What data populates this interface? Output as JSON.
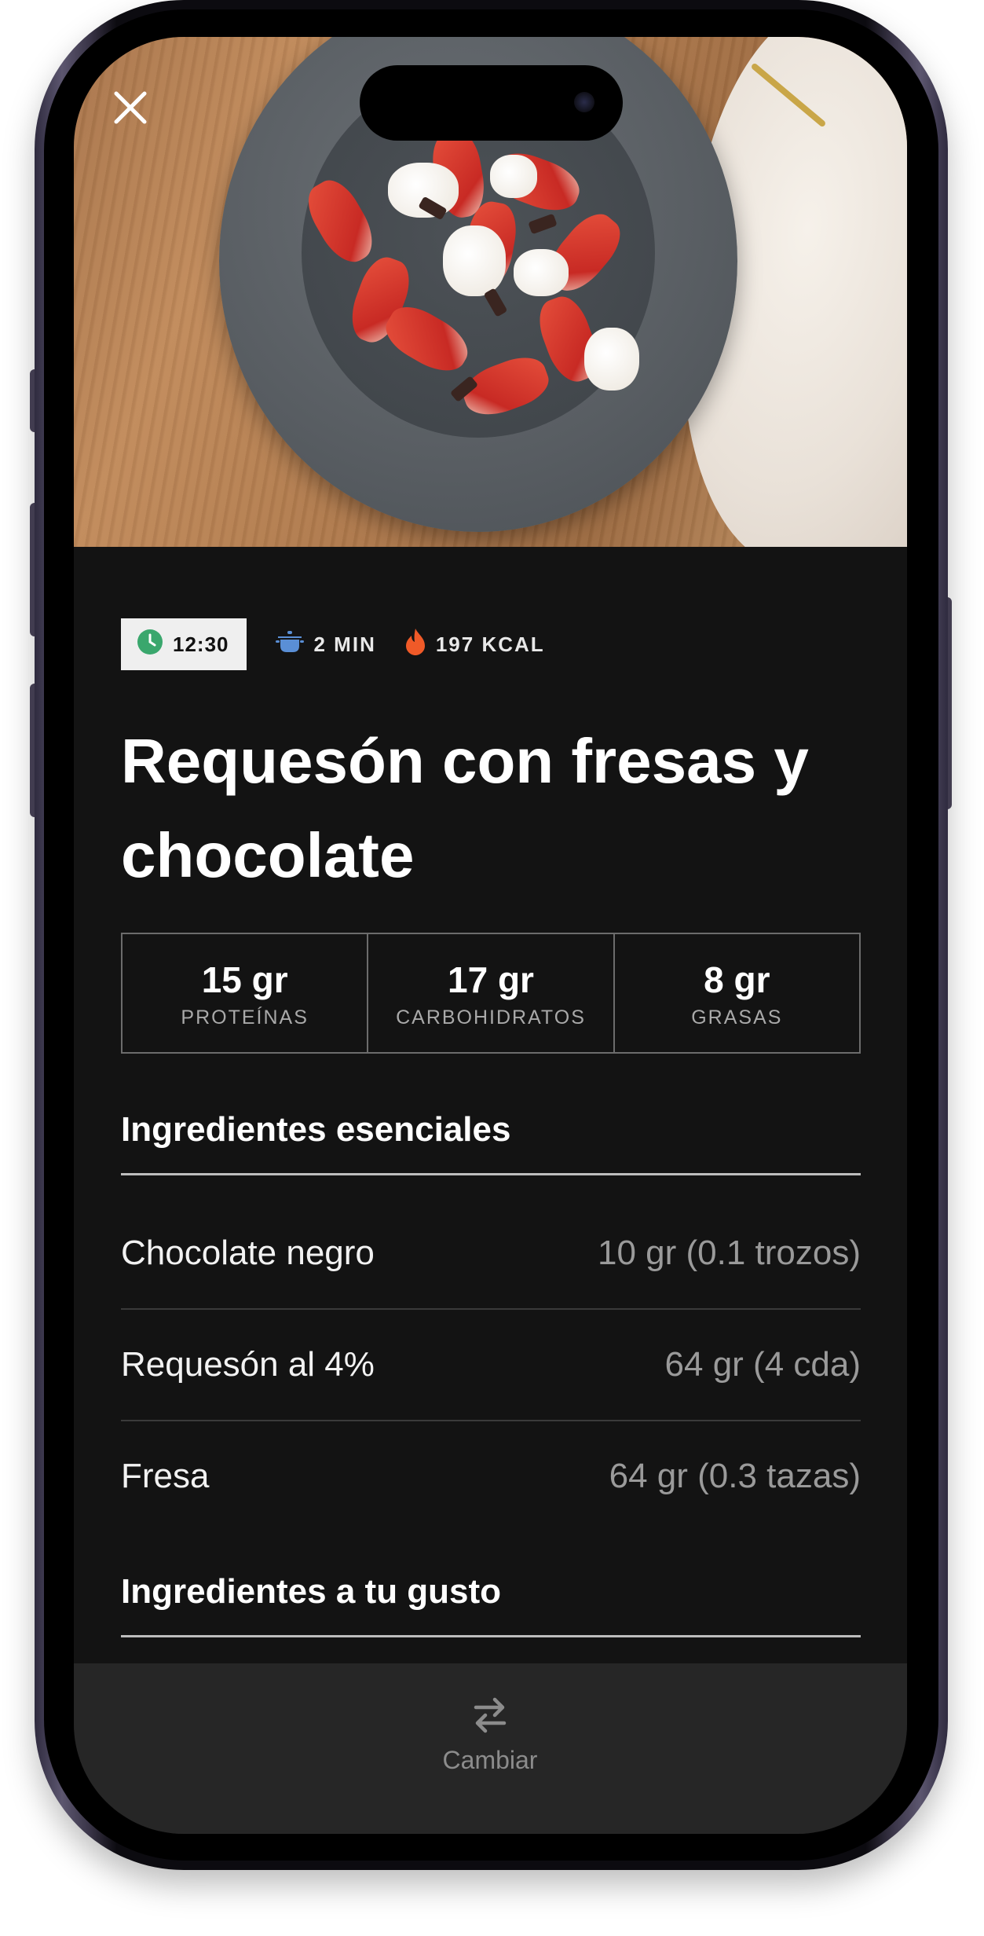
{
  "header": {
    "close_icon": "close-icon"
  },
  "meta": {
    "time": "12:30",
    "time_icon": "clock-icon",
    "prep_time": "2 MIN",
    "prep_icon": "pot-icon",
    "calories": "197 KCAL",
    "calories_icon": "flame-icon"
  },
  "recipe": {
    "title": "Requesón con fresas y chocolate"
  },
  "macros": [
    {
      "value": "15 gr",
      "label": "PROTEÍNAS"
    },
    {
      "value": "17 gr",
      "label": "CARBOHIDRATOS"
    },
    {
      "value": "8 gr",
      "label": "GRASAS"
    }
  ],
  "essential": {
    "title": "Ingredientes esenciales",
    "items": [
      {
        "name": "Chocolate negro",
        "qty": "10 gr (0.1 trozos)"
      },
      {
        "name": "Requesón al 4%",
        "qty": "64 gr (4 cda)"
      },
      {
        "name": "Fresa",
        "qty": "64 gr (0.3 tazas)"
      }
    ]
  },
  "optional": {
    "title": "Ingredientes a tu gusto"
  },
  "bottom_bar": {
    "switch_label": "Cambiar",
    "switch_icon": "swap-arrows-icon"
  },
  "colors": {
    "background": "#131313",
    "clock_green": "#3aa76d",
    "pot_blue": "#5a8fd6",
    "flame_orange": "#f05a28"
  }
}
